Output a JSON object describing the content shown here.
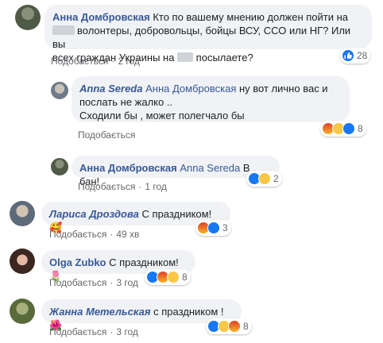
{
  "comments": [
    {
      "author": "Анна Домбровская",
      "text_parts": [
        "Кто по вашему мнению должен пойти на",
        "волонтеры, добровольцы, бойцы ВСУ, ССО или НГ? Или вы",
        "всех граждан Украины на ",
        " посылаете?"
      ],
      "action": "Подобається",
      "time": "2 год",
      "reaction_count": "28"
    },
    {
      "author": "Anna Sereda",
      "mention": "Анна Домбровская",
      "text_parts": [
        "ну вот лично вас и",
        "послать не жалко ..",
        "Сходили бы , может полегчало бы"
      ],
      "action": "Подобається",
      "reaction_count": "8"
    },
    {
      "author": "Анна Домбровская",
      "mention": "Anna Sereda",
      "text": "В бан!",
      "action": "Подобається",
      "time": "1 год",
      "reaction_count": "2"
    },
    {
      "author": "Лариса Дроздова",
      "text": "С праздником!🥰",
      "action": "Подобається",
      "time": "49 хв",
      "reaction_count": "3"
    },
    {
      "author": "Olga Zubko",
      "text": "С праздником!🌷",
      "action": "Подобається",
      "time": "3 год",
      "reaction_count": "8"
    },
    {
      "author": "Жанна Метельская",
      "text": "с праздником ! 🌺",
      "action": "Подобається",
      "time": "3 год",
      "reaction_count": "8"
    }
  ],
  "separator": "·",
  "colors": {
    "bubble": "#f0f2f5",
    "author": "#385898",
    "meta": "#65676b",
    "like": "#1877f2"
  }
}
